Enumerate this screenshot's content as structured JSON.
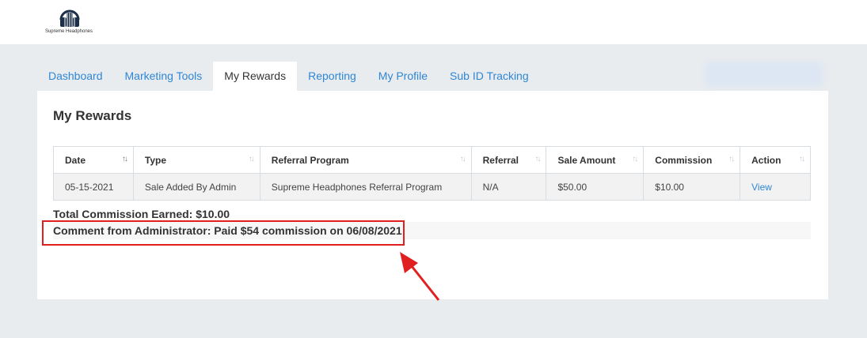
{
  "brand": {
    "name": "Supreme Headphones"
  },
  "tabs": [
    {
      "label": "Dashboard"
    },
    {
      "label": "Marketing Tools"
    },
    {
      "label": "My Rewards"
    },
    {
      "label": "Reporting"
    },
    {
      "label": "My Profile"
    },
    {
      "label": "Sub ID Tracking"
    }
  ],
  "active_tab": "My Rewards",
  "page": {
    "title": "My Rewards",
    "total_label": "Total Commission Earned: $10.00",
    "comment_label": "Comment from Administrator: Paid $54 commission on 06/08/2021"
  },
  "table": {
    "columns": [
      "Date",
      "Type",
      "Referral Program",
      "Referral",
      "Sale Amount",
      "Commission",
      "Action"
    ],
    "rows": [
      [
        "05-15-2021",
        "Sale Added By Admin",
        "Supreme Headphones Referral Program",
        "N/A",
        "$50.00",
        "$10.00",
        "View"
      ]
    ]
  },
  "colors": {
    "accent": "#2f86d4",
    "annotation": "#e02020",
    "background": "#e9ecef"
  },
  "icons": {
    "logo": "headphones-icon",
    "sort": "sort-icon"
  }
}
